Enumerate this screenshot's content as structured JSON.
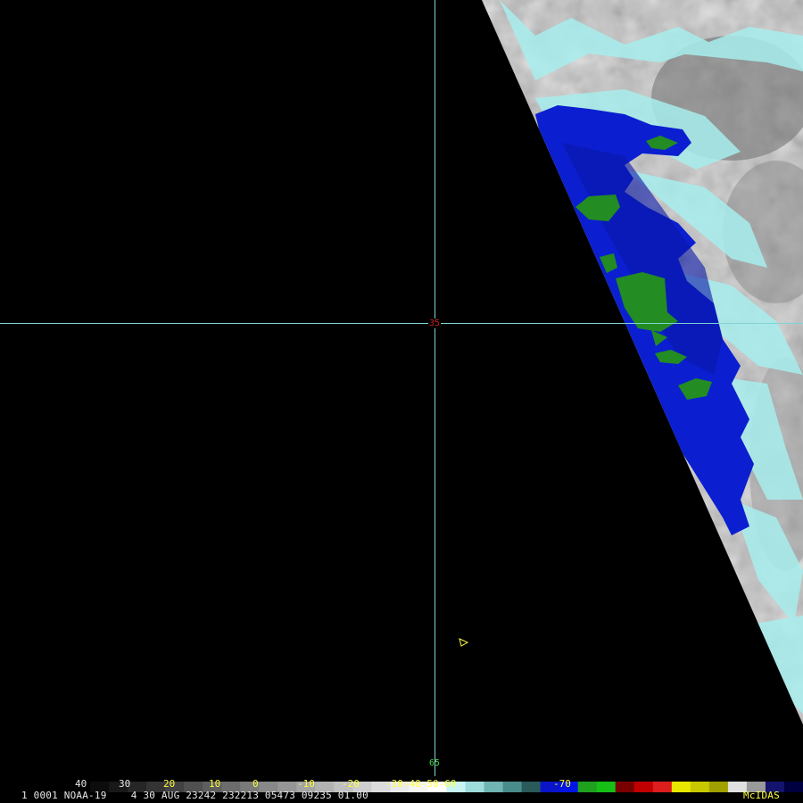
{
  "grid": {
    "lat_label": "35",
    "lon_label": "65",
    "line_color": "#7fd4d4",
    "lat_label_color": "#c81e1e",
    "lon_label_color": "#49d849"
  },
  "colors": {
    "background": "#000000",
    "deep_convection_blue": "#0a1ecc",
    "intense_convection_green": "#228b22",
    "cloud_edge_cyan": "#9fe9e9",
    "cold_cloud_gray": "#c8c8c8",
    "marker_yellow": "#ffff40"
  },
  "marker": {
    "icon": "triangle-marker-icon"
  },
  "scale": {
    "labels": [
      {
        "text": "40",
        "color": "#e8e8e8"
      },
      {
        "text": "30",
        "color": "#e8e8e8"
      },
      {
        "text": "20",
        "color": "#ffff40"
      },
      {
        "text": "10",
        "color": "#ffff40"
      },
      {
        "text": "0",
        "color": "#ffff40"
      },
      {
        "text": "-10",
        "color": "#ffff40"
      },
      {
        "text": "-20",
        "color": "#ffff40"
      },
      {
        "text": "-30-40-50-60",
        "color": "#ffff40"
      },
      {
        "text": "-70",
        "color": "#ffff40"
      }
    ],
    "bands": [
      "#000000",
      "#0c0c0c",
      "#181818",
      "#262626",
      "#343434",
      "#424242",
      "#505050",
      "#5e5e5e",
      "#6c6c6c",
      "#7a7a7a",
      "#888888",
      "#969696",
      "#a4a4a4",
      "#b2b2b2",
      "#c0c0c0",
      "#cecece",
      "#dcdcdc",
      "#eaeaea",
      "#f6f6f6",
      "#ffffff",
      "#c8f4f4",
      "#9edcdc",
      "#70b4b4",
      "#4a8c8c",
      "#2a5a5a",
      "#0a14c8",
      "#0014e6",
      "#1fa01f",
      "#16c016",
      "#780000",
      "#c00000",
      "#dc1e1e",
      "#e8e800",
      "#c8c800",
      "#a0a000",
      "#e0e0e0",
      "#9a9a9a",
      "#14146e",
      "#000040"
    ]
  },
  "status": {
    "left": "1 0001 NOAA-19    4 30 AUG 23242 232213 05473 09235 01.00",
    "right": "McIDAS"
  }
}
